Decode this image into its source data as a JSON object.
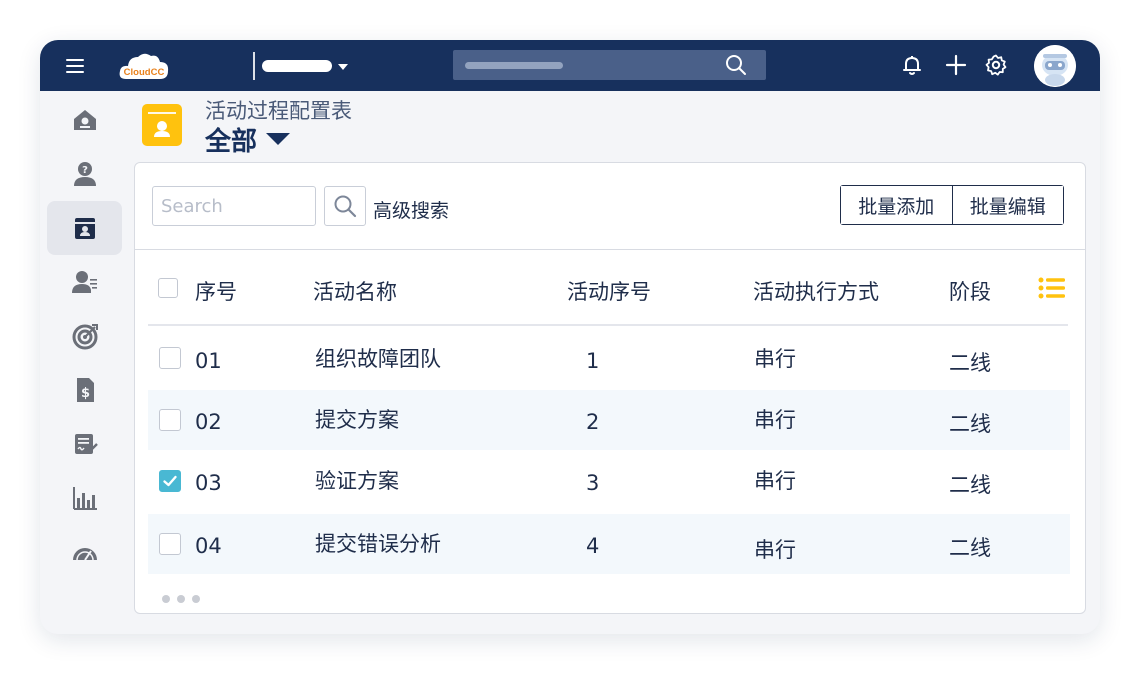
{
  "brand": {
    "logo_text": "CloudCC",
    "logo_color": "#e8811d"
  },
  "colors": {
    "topbar": "#17305d",
    "accent": "#ffc20e",
    "checkbox_checked": "#49b8d3",
    "alt_row": "#f3f8fc"
  },
  "topbar_icons": [
    "menu-icon",
    "bell-icon",
    "plus-icon",
    "gear-icon",
    "avatar"
  ],
  "sidebar_icons": [
    "home-icon",
    "help-user-icon",
    "calendar-card-icon",
    "contact-list-icon",
    "target-icon",
    "invoice-dollar-icon",
    "signature-doc-icon",
    "bar-chart-icon",
    "gauge-icon"
  ],
  "header": {
    "subtitle": "活动过程配置表",
    "title": "全部"
  },
  "toolbar": {
    "search_placeholder": "Search",
    "advanced_search": "高级搜索",
    "batch_add": "批量添加",
    "batch_edit": "批量编辑"
  },
  "table": {
    "columns": [
      "序号",
      "活动名称",
      "活动序号",
      "活动执行方式",
      "阶段"
    ],
    "rows": [
      {
        "checked": false,
        "no": "01",
        "name": "组织故障团队",
        "seq": "1",
        "mode": "串行",
        "stage": "二线"
      },
      {
        "checked": false,
        "no": "02",
        "name": "提交方案",
        "seq": "2",
        "mode": "串行",
        "stage": "二线"
      },
      {
        "checked": true,
        "no": "03",
        "name": "验证方案",
        "seq": "3",
        "mode": "串行",
        "stage": "二线"
      },
      {
        "checked": false,
        "no": "04",
        "name": "提交错误分析",
        "seq": "4",
        "mode": "串行",
        "stage": "二线"
      }
    ]
  }
}
